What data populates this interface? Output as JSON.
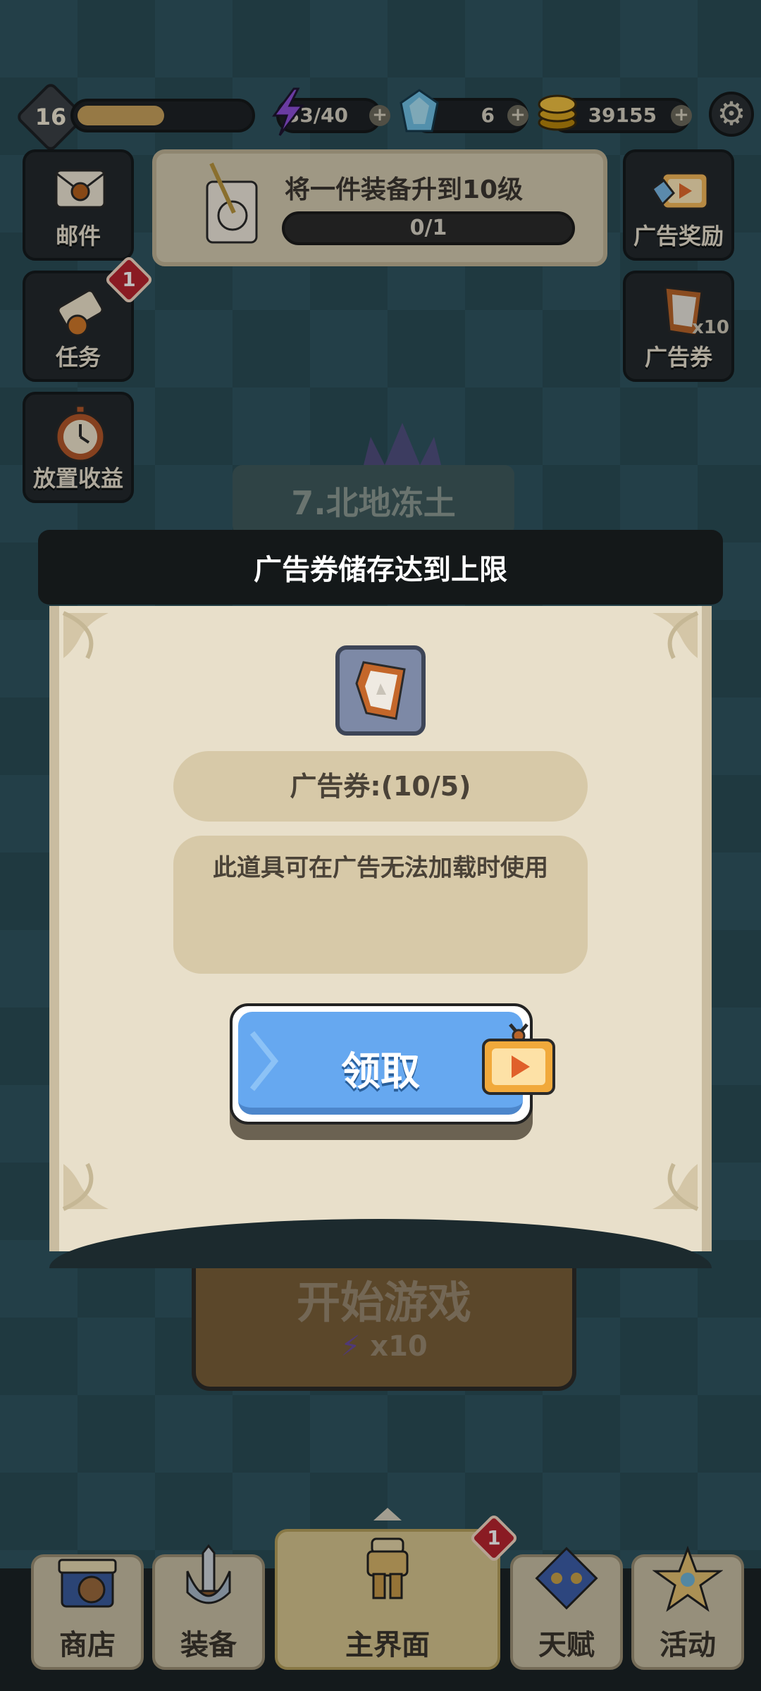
{
  "colors": {
    "accent_blue": "#66a8f0",
    "badge_red": "#b9252f",
    "panel_cream": "#e8dfca"
  },
  "top_bar": {
    "level": "16",
    "xp_progress": 0.51,
    "energy": "33/40",
    "gems": "6",
    "coins": "39155",
    "settings_icon": "gear-icon"
  },
  "side_left": [
    {
      "label": "邮件",
      "icon": "mail-icon"
    },
    {
      "label": "任务",
      "icon": "scroll-quest-icon",
      "badge": "1"
    },
    {
      "label": "放置收益",
      "icon": "stopwatch-icon"
    }
  ],
  "side_right": [
    {
      "label": "广告奖励",
      "icon": "tv-play-icon"
    },
    {
      "label": "广告券",
      "icon": "ad-ticket-icon",
      "count": "x10"
    }
  ],
  "quest": {
    "text": "将一件装备升到10级",
    "progress": "0/1"
  },
  "stage": {
    "name": "7.北地冻土"
  },
  "modal": {
    "title": "广告券储存达到上限",
    "count_text": "广告券:(10/5)",
    "description": "此道具可在广告无法加载时使用",
    "claim_label": "领取"
  },
  "start_game": {
    "label": "开始游戏",
    "cost": "x10"
  },
  "bottom_nav": [
    {
      "label": "商店",
      "icon": "shop-icon"
    },
    {
      "label": "装备",
      "icon": "sword-icon"
    },
    {
      "label": "主界面",
      "icon": "armor-icon",
      "badge": "1",
      "active": true
    },
    {
      "label": "天赋",
      "icon": "talent-icon"
    },
    {
      "label": "活动",
      "icon": "event-icon"
    }
  ]
}
